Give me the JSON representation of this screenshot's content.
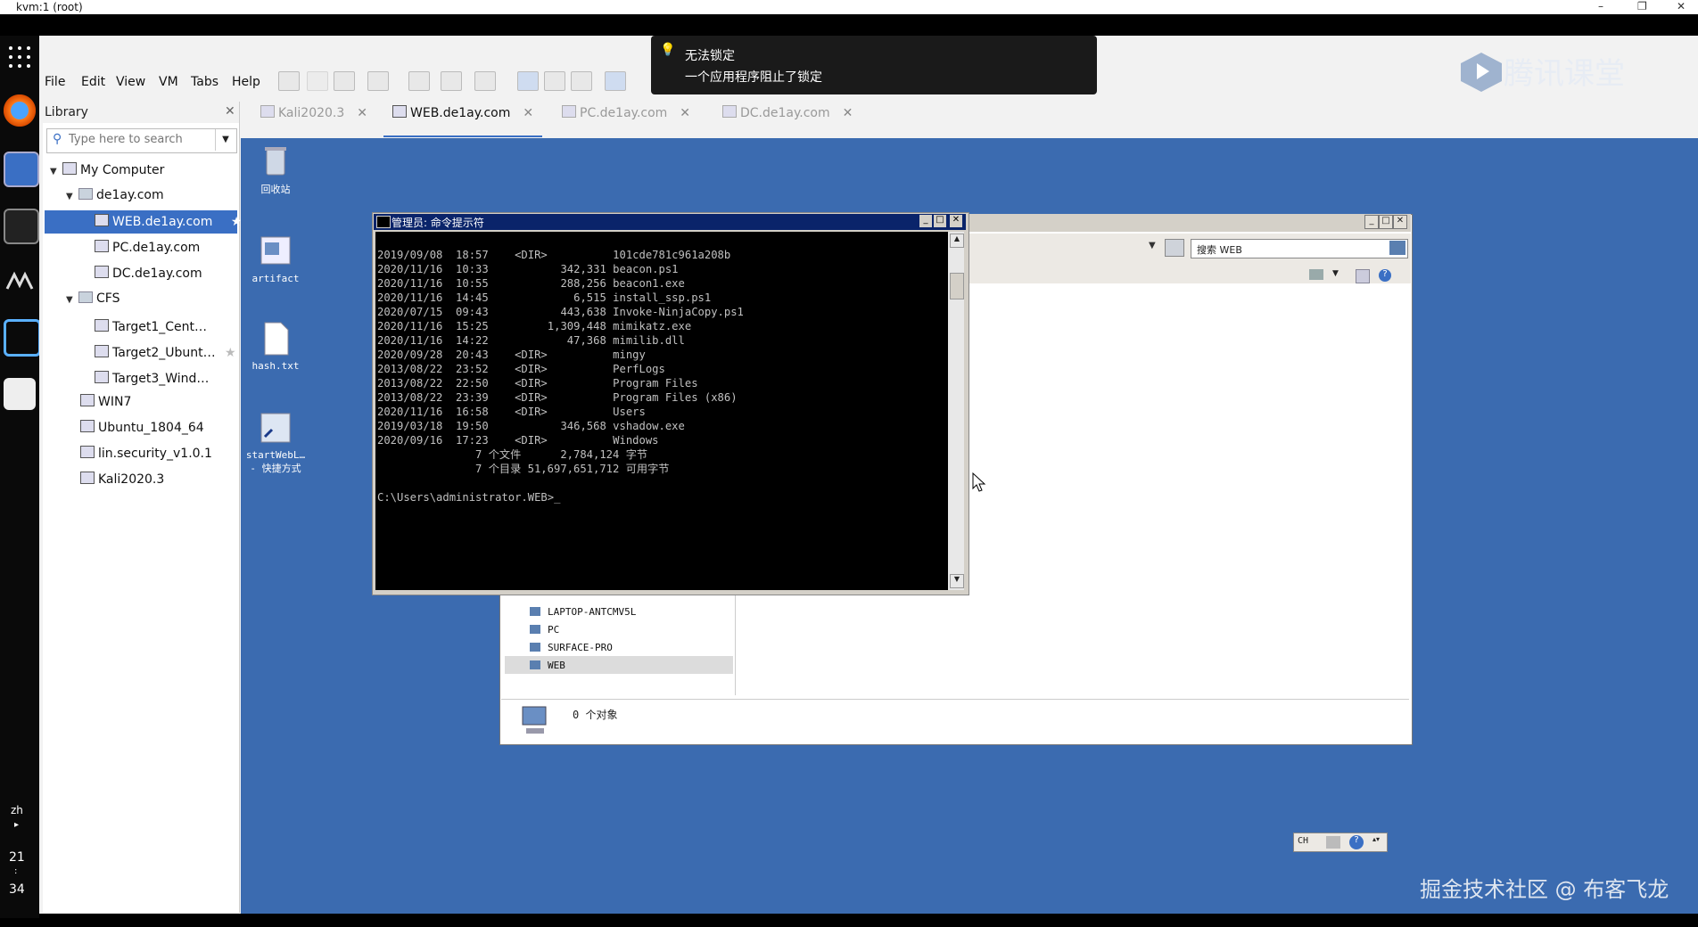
{
  "window": {
    "title": "kvm:1 (root)",
    "controls": [
      "–",
      "❐",
      "✕"
    ]
  },
  "menubar": {
    "items": [
      "File",
      "Edit",
      "View",
      "VM",
      "Tabs",
      "Help"
    ]
  },
  "library": {
    "title": "Library",
    "search_placeholder": "Type here to search",
    "tree": [
      {
        "label": "My Computer"
      },
      {
        "label": "de1ay.com"
      },
      {
        "label": "WEB.de1ay.com"
      },
      {
        "label": "PC.de1ay.com"
      },
      {
        "label": "DC.de1ay.com"
      },
      {
        "label": "CFS"
      },
      {
        "label": "Target1_Cent…"
      },
      {
        "label": "Target2_Ubunt…"
      },
      {
        "label": "Target3_Wind…"
      },
      {
        "label": "WIN7"
      },
      {
        "label": "Ubuntu_1804_64"
      },
      {
        "label": "lin.security_v1.0.1"
      },
      {
        "label": "Kali2020.3"
      }
    ]
  },
  "tabs": [
    {
      "label": "Kali2020.3"
    },
    {
      "label": "WEB.de1ay.com"
    },
    {
      "label": "PC.de1ay.com"
    },
    {
      "label": "DC.de1ay.com"
    }
  ],
  "desktop": {
    "icons": [
      {
        "label": "回收站"
      },
      {
        "label": "artifact"
      },
      {
        "label": "hash.txt"
      },
      {
        "label": "startWebL…"
      },
      {
        "label": "- 快捷方式"
      }
    ]
  },
  "explorer": {
    "search_text": "搜索 WEB",
    "network_items": [
      "LAPTOP-ANTCMV5L",
      "PC",
      "SURFACE-PRO",
      "WEB"
    ],
    "status": "0 个对象"
  },
  "cmd": {
    "title": "管理员: 命令提示符",
    "lines": [
      "2019/09/08  18:57    <DIR>          101cde781c961a208b",
      "2020/11/16  10:33           342,331 beacon.ps1",
      "2020/11/16  10:55           288,256 beacon1.exe",
      "2020/11/16  14:45             6,515 install_ssp.ps1",
      "2020/07/15  09:43           443,638 Invoke-NinjaCopy.ps1",
      "2020/11/16  15:25         1,309,448 mimikatz.exe",
      "2020/11/16  14:22            47,368 mimilib.dll",
      "2020/09/28  20:43    <DIR>          mingy",
      "2013/08/22  23:52    <DIR>          PerfLogs",
      "2013/08/22  22:50    <DIR>          Program Files",
      "2013/08/22  23:39    <DIR>          Program Files (x86)",
      "2020/11/16  16:58    <DIR>          Users",
      "2019/03/18  19:50           346,568 vshadow.exe",
      "2020/09/16  17:23    <DIR>          Windows",
      "               7 个文件      2,784,124 字节",
      "               7 个目录 51,697,651,712 可用字节",
      "",
      "C:\\Users\\administrator.WEB>_"
    ]
  },
  "notification": {
    "title": "无法锁定",
    "body": "一个应用程序阻止了锁定"
  },
  "brand": {
    "text": "腾讯课堂"
  },
  "taskbar": {
    "lang": "CH"
  },
  "dock": {
    "lang": "zh",
    "time_hour": "21",
    "time_min": "34"
  },
  "watermark": {
    "text": "掘金技术社区 @ 布客飞龙"
  },
  "colors": {
    "desktop": "#3b6bb0",
    "selection": "#3a6fc4",
    "cmd_title": "#0a246a"
  }
}
